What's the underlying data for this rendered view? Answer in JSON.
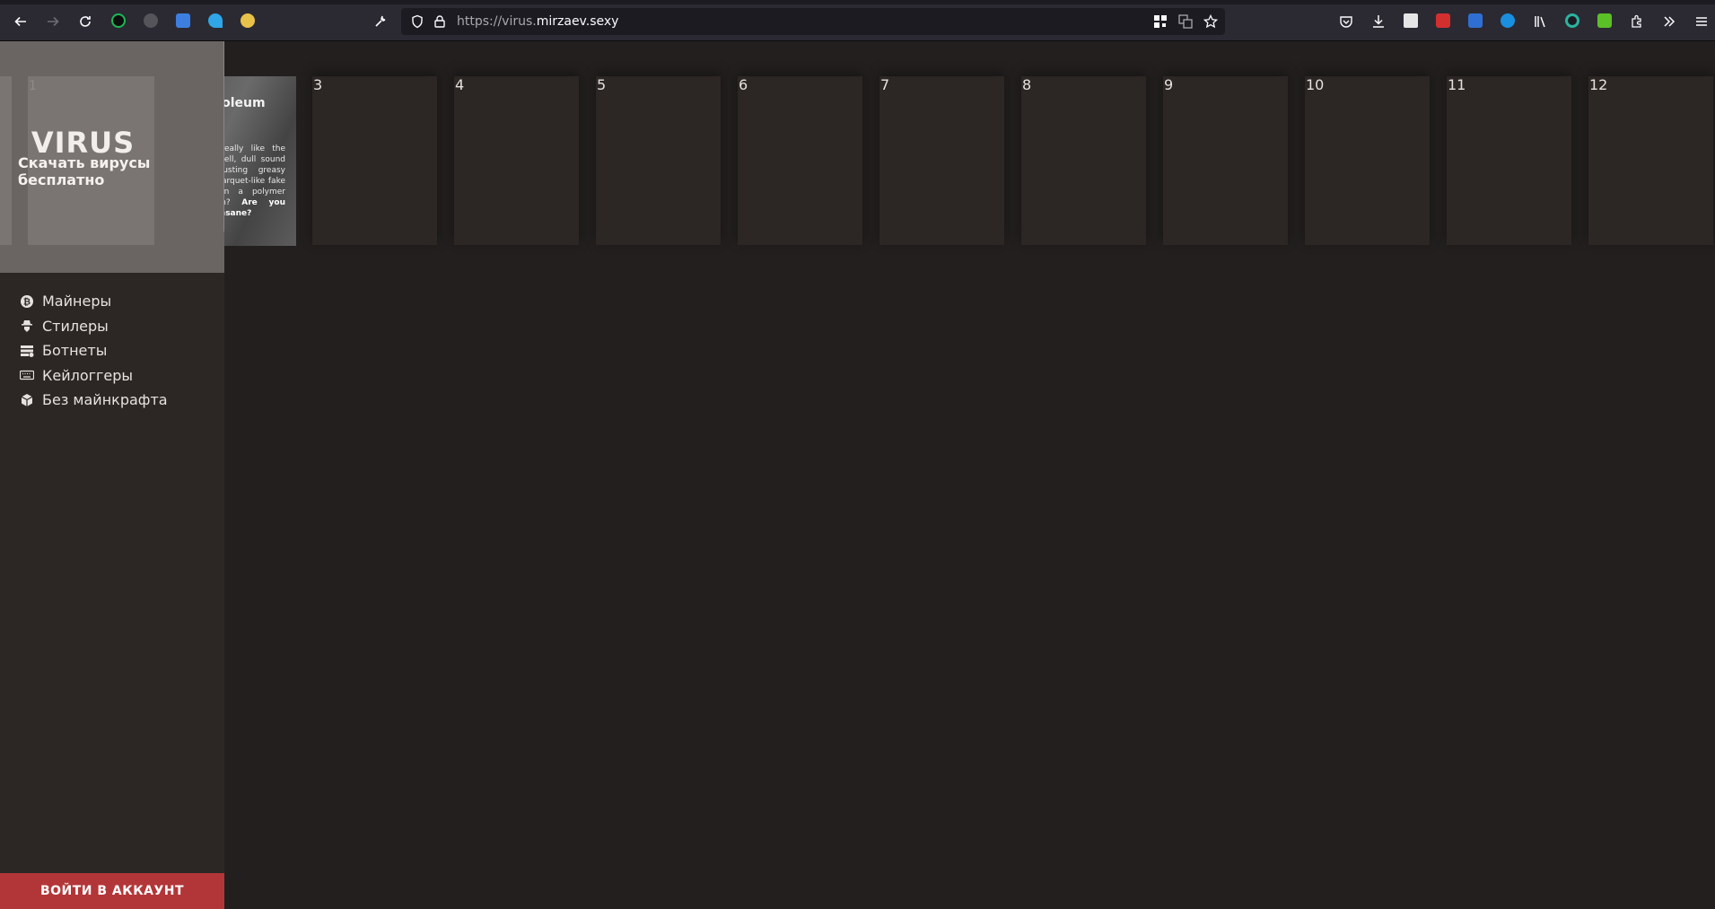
{
  "browser": {
    "url_protocol": "https://virus.",
    "url_domain": "mirzaev.sexy"
  },
  "sidebar": {
    "logo": "VIRUS",
    "tagline": "Скачать вирусы бесплатно",
    "brand_card_number": "1",
    "items": [
      {
        "label": "Майнеры",
        "icon": "bitcoin-icon"
      },
      {
        "label": "Стилеры",
        "icon": "spy-icon"
      },
      {
        "label": "Ботнеты",
        "icon": "server-icon"
      },
      {
        "label": "Кейлоггеры",
        "icon": "keyboard-icon"
      },
      {
        "label": "Без майнкрафта",
        "icon": "cube-icon"
      }
    ],
    "login_label": "ВОЙТИ В АККАУНТ"
  },
  "featured": {
    "title": "Linoleum",
    "body": "Do you really like the rotting smell, dull sound and disgusting greasy shine of parquet-like fake pattern on a polymer base film?",
    "emphasis": "Are you fucking insane?"
  },
  "cards": [
    "3",
    "4",
    "5",
    "6",
    "7",
    "8",
    "9",
    "10",
    "11",
    "12"
  ],
  "colors": {
    "page_bg": "#221f1e",
    "sidebar_bg": "#2c2725",
    "brand_bg": "#6a6563",
    "card_bg": "#2c2625",
    "login_accent": "#b23638"
  }
}
